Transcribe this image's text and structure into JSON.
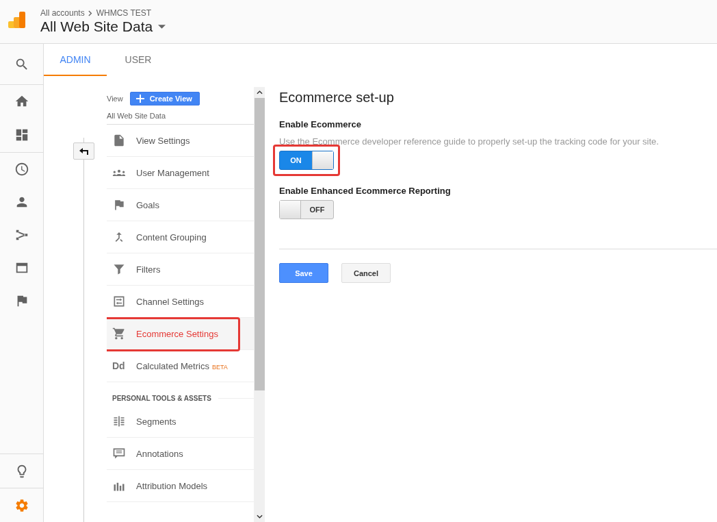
{
  "header": {
    "breadcrumb": [
      "All accounts",
      "WHMCS TEST"
    ],
    "title": "All Web Site Data"
  },
  "rail": {
    "top": [
      {
        "selected": false
      },
      {
        "selected": false
      },
      {
        "selected": false
      },
      {
        "selected": false
      },
      {
        "selected": false
      },
      {
        "selected": false
      },
      {
        "selected": false
      },
      {
        "selected": false
      }
    ],
    "bottom": [
      {
        "selected": false
      },
      {
        "selected": true
      }
    ]
  },
  "tabs": [
    {
      "label": "ADMIN",
      "selected": true
    },
    {
      "label": "USER",
      "selected": false
    }
  ],
  "view": {
    "label": "View",
    "create_button": "Create View",
    "name": "All Web Site Data"
  },
  "menu": [
    {
      "label": "View Settings",
      "selected": false,
      "highlighted": false
    },
    {
      "label": "User Management",
      "selected": false,
      "highlighted": false
    },
    {
      "label": "Goals",
      "selected": false,
      "highlighted": false
    },
    {
      "label": "Content Grouping",
      "selected": false,
      "highlighted": false
    },
    {
      "label": "Filters",
      "selected": false,
      "highlighted": false
    },
    {
      "label": "Channel Settings",
      "selected": false,
      "highlighted": false
    },
    {
      "label": "Ecommerce Settings",
      "selected": true,
      "highlighted": true
    },
    {
      "label": "Calculated Metrics",
      "icon_text": "Dd",
      "badge": "BETA",
      "selected": false,
      "highlighted": false
    }
  ],
  "section": "PERSONAL TOOLS & ASSETS",
  "tools": [
    {
      "label": "Segments",
      "selected": false
    },
    {
      "label": "Annotations",
      "selected": false
    },
    {
      "label": "Attribution Models",
      "selected": false
    }
  ],
  "setup": {
    "title": "Ecommerce set-up",
    "options": [
      {
        "label": "Enable Ecommerce",
        "hint": "Use the Ecommerce developer reference guide to properly set-up the tracking code for your site.",
        "on": true,
        "state_label": "ON",
        "highlighted": true
      },
      {
        "label": "Enable Enhanced Ecommerce Reporting",
        "on": false,
        "state_label": "OFF",
        "highlighted": false
      }
    ],
    "save": "Save",
    "cancel": "Cancel"
  }
}
